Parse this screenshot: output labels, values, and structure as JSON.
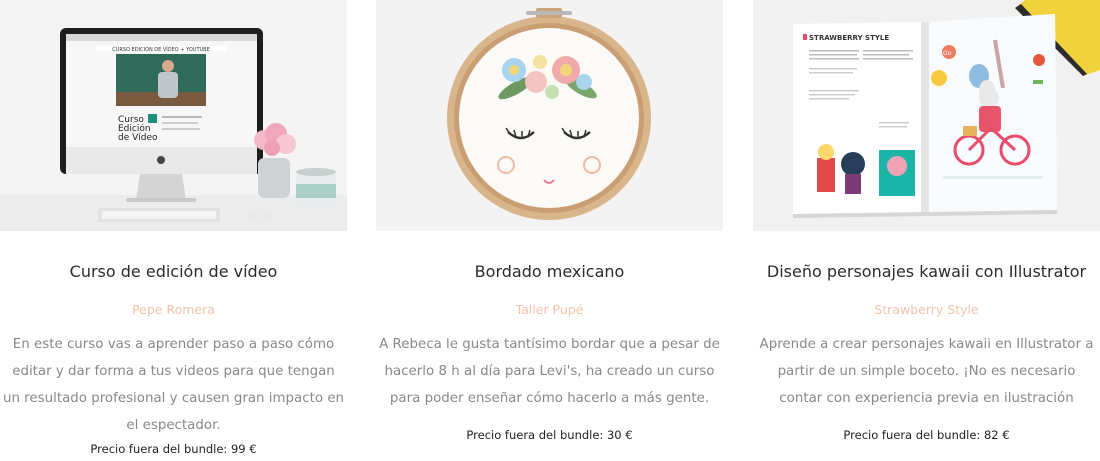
{
  "courses": [
    {
      "title": "Curso de edición de vídeo",
      "author": "Pepe Romera",
      "description": "En este curso vas a aprender paso a paso cómo editar y dar forma a tus videos para que tengan un resultado profesional y causen gran impacto en el espectador.",
      "price": "Precio fuera del bundle: 99 €",
      "image": {
        "screen_header": "CURSO EDICIÓN DE VÍDEO + YOUTUBE",
        "screen_logo": "Curso Edición de Vídeo",
        "icon": "imac-desk-photo"
      }
    },
    {
      "title": "Bordado mexicano",
      "author": "Taller Pupé",
      "description": "A Rebeca le gusta tantísimo bordar que a pesar de hacerlo 8 h al día para Levi's, ha creado un curso para poder enseñar cómo hacerlo a más gente.",
      "price": "Precio fuera del bundle: 30 €",
      "image": {
        "icon": "embroidery-hoop-photo"
      }
    },
    {
      "title": "Diseño personajes kawaii con Illustrator",
      "author": "Strawberry Style",
      "description": "Aprende a crear personajes kawaii en Illustrator a partir de un simple boceto. ¡No es necesario contar con experiencia previa en ilustración",
      "price": "Precio fuera del bundle: 82 €",
      "image": {
        "book_heading": "STRAWBERRY STYLE",
        "icon": "open-book-photo"
      }
    }
  ],
  "colors": {
    "author": "#f2c2ab",
    "title": "#2b2b2b",
    "description": "#888888",
    "price": "#222222"
  }
}
